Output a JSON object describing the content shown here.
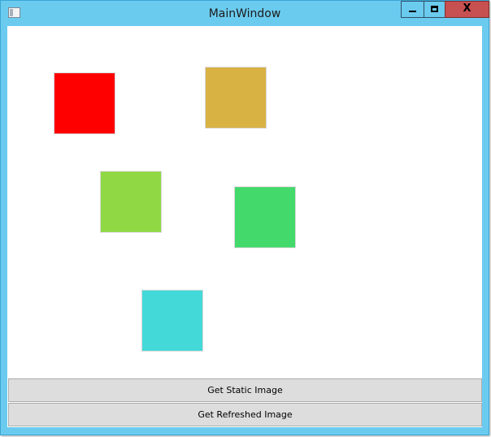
{
  "window": {
    "title": "MainWindow",
    "caption_buttons": {
      "minimize_icon": "minimize-icon",
      "maximize_icon": "maximize-icon",
      "close_glyph": "X"
    },
    "frame_color": "#6bcbef",
    "close_color": "#c75050"
  },
  "canvas": {
    "squares": [
      {
        "name": "red-square",
        "color": "#ff0000"
      },
      {
        "name": "gold-square",
        "color": "#d9b244"
      },
      {
        "name": "lime-square",
        "color": "#90d945"
      },
      {
        "name": "green-square",
        "color": "#44d96b"
      },
      {
        "name": "cyan-square",
        "color": "#44d9d9"
      }
    ]
  },
  "buttons": {
    "static_label": "Get Static Image",
    "refresh_label": "Get Refreshed Image"
  }
}
